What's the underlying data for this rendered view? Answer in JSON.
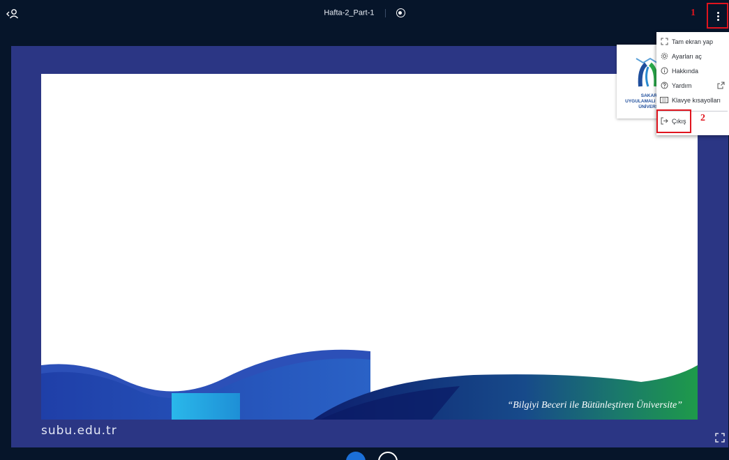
{
  "header": {
    "title": "Hafta-2_Part-1",
    "user_icon": "user-back-icon",
    "record_icon": "record-icon",
    "menu_icon": "kebab-menu-icon"
  },
  "annotations": {
    "step1": "1",
    "step2": "2",
    "highlight_color": "#e0141e"
  },
  "menu": {
    "items": [
      {
        "label": "Tam ekran yap",
        "icon": "fullscreen-icon"
      },
      {
        "label": "Ayarları aç",
        "icon": "gear-icon"
      },
      {
        "label": "Hakkında",
        "icon": "info-icon"
      },
      {
        "label": "Yardım",
        "icon": "help-icon",
        "extra_icon": "external-link-icon"
      },
      {
        "label": "Klavye kısayolları",
        "icon": "keyboard-icon"
      }
    ],
    "exit": {
      "label": "Çıkış",
      "icon": "exit-icon"
    }
  },
  "slide": {
    "tagline": "“Bilgiyi Beceri ile Bütünleştiren Üniversite”",
    "url": "subu.edu.tr",
    "logo_lines": [
      "SAKARY",
      "UYGULAMALI B",
      "ÜNİVERSİ"
    ],
    "colors": {
      "frame": "#2b3684",
      "wave_dark": "#12237a",
      "wave_light": "#2aa8e0",
      "wave_green": "#1e9a4a"
    }
  },
  "controls": {
    "fullscreen_icon": "fullscreen-icon",
    "theme_accent": "#1b6fd8"
  }
}
